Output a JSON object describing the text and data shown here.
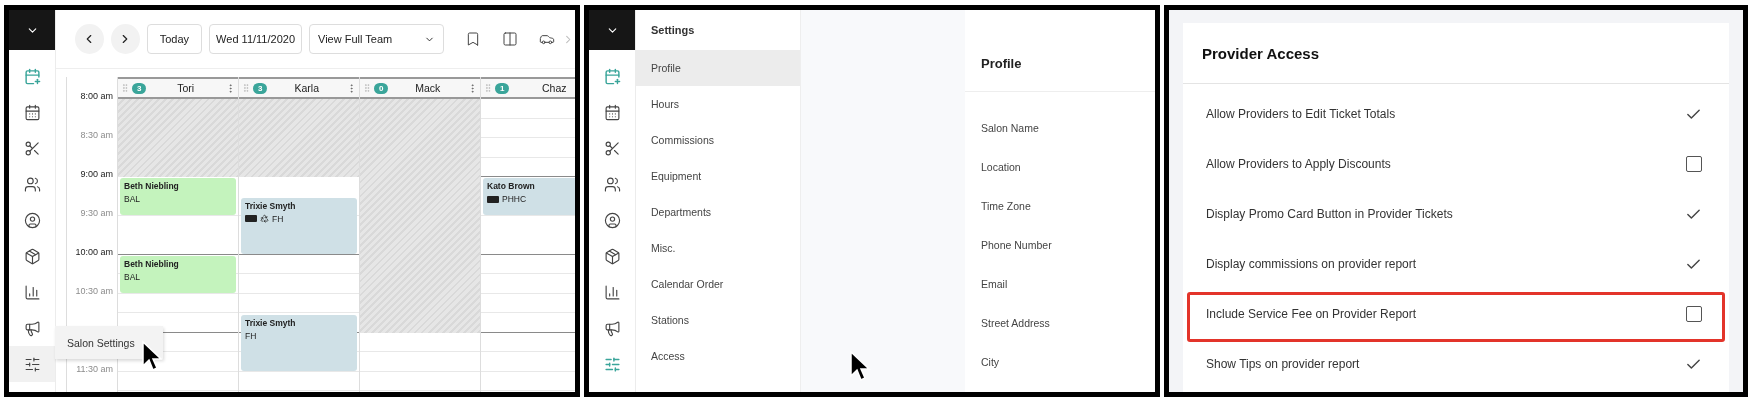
{
  "calendar_view": {
    "sidebar": {
      "items": [
        {
          "highlighted": true,
          "hovered": false
        },
        {
          "highlighted": false,
          "hovered": false
        },
        {
          "highlighted": false,
          "hovered": false
        },
        {
          "highlighted": false,
          "hovered": false
        },
        {
          "highlighted": false,
          "hovered": false
        },
        {
          "highlighted": false,
          "hovered": false
        },
        {
          "highlighted": false,
          "hovered": false
        },
        {
          "highlighted": false,
          "hovered": false
        },
        {
          "highlighted": false,
          "hovered": true
        }
      ]
    },
    "toolbar": {
      "today": "Today",
      "date": "Wed 11/11/2020",
      "team_select": "View Full Team"
    },
    "time_labels": [
      {
        "label": "8:00 am",
        "faded": false
      },
      {
        "label": "8:30 am",
        "faded": true
      },
      {
        "label": "9:00 am",
        "faded": false
      },
      {
        "label": "9:30 am",
        "faded": true
      },
      {
        "label": "10:00 am",
        "faded": false
      },
      {
        "label": "10:30 am",
        "faded": true
      },
      {
        "label": "11:30 am",
        "faded": true
      }
    ],
    "columns": [
      {
        "name": "Tori",
        "count": "3",
        "blocked": true,
        "appointments": [
          {
            "client": "Beth Niebling",
            "service": "BAL",
            "color": "#c4f3bd"
          },
          {
            "client": "Beth Niebling",
            "service": "BAL",
            "color": "#c4f3bd"
          }
        ]
      },
      {
        "name": "Karla",
        "count": "3",
        "blocked": true,
        "appointments": [
          {
            "client": "Trixie Smyth",
            "service": "FH",
            "color": "#cfe0e6",
            "icons": [
              {
                "kind": "card"
              },
              {
                "kind": "recycle"
              }
            ]
          },
          {
            "client": "Trixie Smyth",
            "service": "FH",
            "color": "#cfe0e6"
          }
        ]
      },
      {
        "name": "Mack",
        "count": "0",
        "blocked": true
      },
      {
        "name": "Chaz",
        "count": "1",
        "blocked": false,
        "appointments": [
          {
            "client": "Kato Brown",
            "service": "PHHC",
            "color": "#cfe0e6",
            "icons": [
              {
                "kind": "card"
              }
            ]
          }
        ]
      }
    ],
    "popup": {
      "label": "Salon Settings"
    }
  },
  "settings_view": {
    "sidebar": {
      "items": [
        {
          "highlighted": true,
          "hovered": false
        },
        {
          "highlighted": false,
          "hovered": false
        },
        {
          "highlighted": false,
          "hovered": false
        },
        {
          "highlighted": false,
          "hovered": false
        },
        {
          "highlighted": false,
          "hovered": false
        },
        {
          "highlighted": false,
          "hovered": false
        },
        {
          "highlighted": false,
          "hovered": false
        },
        {
          "highlighted": false,
          "hovered": false
        },
        {
          "highlighted": true,
          "hovered": false
        }
      ]
    },
    "menu_title": "Settings",
    "menu": [
      {
        "label": "Profile",
        "selected": true
      },
      {
        "label": "Hours",
        "selected": false
      },
      {
        "label": "Commissions",
        "selected": false
      },
      {
        "label": "Equipment",
        "selected": false
      },
      {
        "label": "Departments",
        "selected": false
      },
      {
        "label": "Misc.",
        "selected": false
      },
      {
        "label": "Calendar Order",
        "selected": false
      },
      {
        "label": "Stations",
        "selected": false
      },
      {
        "label": "Access",
        "selected": false
      }
    ],
    "card_title": "Profile",
    "field_labels": [
      "Salon Name",
      "Location",
      "Time Zone",
      "Phone Number",
      "Email",
      "Street Address",
      "City"
    ]
  },
  "provider_access": {
    "title": "Provider Access",
    "options": [
      {
        "label": "Allow Providers to Edit Ticket Totals",
        "checked": true,
        "highlighted": false
      },
      {
        "label": "Allow Providers to Apply Discounts",
        "checked": false,
        "highlighted": false
      },
      {
        "label": "Display Promo Card Button in Provider Tickets",
        "checked": true,
        "highlighted": false
      },
      {
        "label": "Display commissions on provider report",
        "checked": true,
        "highlighted": false
      },
      {
        "label": "Include Service Fee on Provider Report",
        "checked": false,
        "highlighted": true
      },
      {
        "label": "Show Tips on provider report",
        "checked": true,
        "highlighted": false
      }
    ]
  }
}
